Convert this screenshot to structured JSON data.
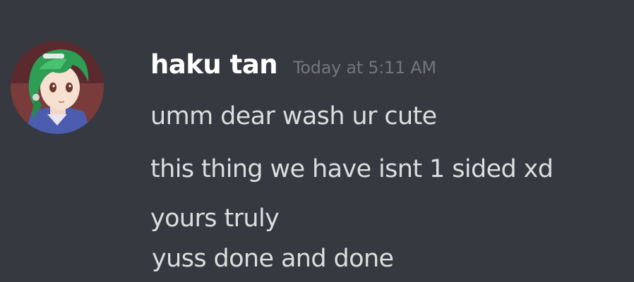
{
  "message": {
    "author": "haku tan",
    "timestamp": "Today at 5:11 AM",
    "avatar_icon": "anime-avatar",
    "lines": [
      "umm dear wash ur cute",
      "this thing we have isnt 1 sided xd",
      "yours truly",
      "yuss done and done"
    ]
  },
  "colors": {
    "background": "#36393f",
    "username": "#ffffff",
    "timestamp": "#72767d",
    "message_text": "#dcddde"
  }
}
